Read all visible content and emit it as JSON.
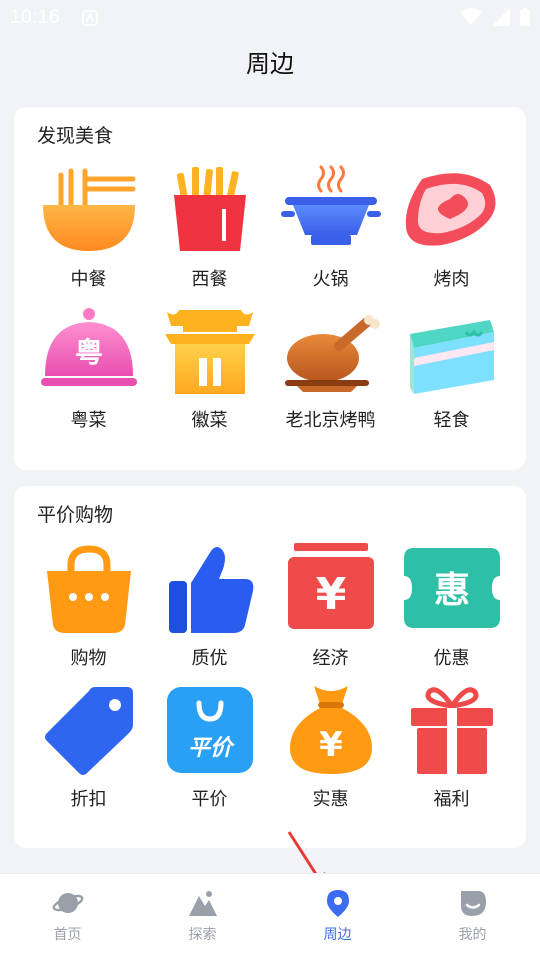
{
  "status": {
    "time": "10:16"
  },
  "header": {
    "title": "周边"
  },
  "food_section": {
    "title": "发现美食",
    "items": [
      {
        "label": "中餐",
        "icon": "noodle-bowl-icon"
      },
      {
        "label": "西餐",
        "icon": "french-fries-icon"
      },
      {
        "label": "火锅",
        "icon": "hotpot-icon"
      },
      {
        "label": "烤肉",
        "icon": "steak-icon"
      },
      {
        "label": "粤菜",
        "icon": "cloche-icon",
        "glyph": "粤"
      },
      {
        "label": "徽菜",
        "icon": "pavilion-icon"
      },
      {
        "label": "老北京烤鸭",
        "icon": "roast-duck-icon"
      },
      {
        "label": "轻食",
        "icon": "cake-slice-icon"
      }
    ]
  },
  "shop_section": {
    "title": "平价购物",
    "items": [
      {
        "label": "购物",
        "icon": "shopping-bag-icon"
      },
      {
        "label": "质优",
        "icon": "thumbs-up-icon"
      },
      {
        "label": "经济",
        "icon": "yuan-box-icon",
        "glyph": "¥"
      },
      {
        "label": "优惠",
        "icon": "coupon-icon",
        "glyph": "惠"
      },
      {
        "label": "折扣",
        "icon": "price-tag-icon"
      },
      {
        "label": "平价",
        "icon": "fair-price-bag-icon",
        "glyph": "平价"
      },
      {
        "label": "实惠",
        "icon": "money-bag-icon",
        "glyph": "¥"
      },
      {
        "label": "福利",
        "icon": "gift-box-icon"
      }
    ]
  },
  "tabbar": {
    "tabs": [
      {
        "label": "首页",
        "icon": "planet-icon",
        "active": false
      },
      {
        "label": "探索",
        "icon": "mountain-icon",
        "active": false
      },
      {
        "label": "周边",
        "icon": "location-pin-icon",
        "active": true
      },
      {
        "label": "我的",
        "icon": "profile-icon",
        "active": false
      }
    ]
  },
  "colors": {
    "accent": "#3b6cf2",
    "background": "#f2f3f7",
    "inactive_tab": "#9aa0aa"
  }
}
